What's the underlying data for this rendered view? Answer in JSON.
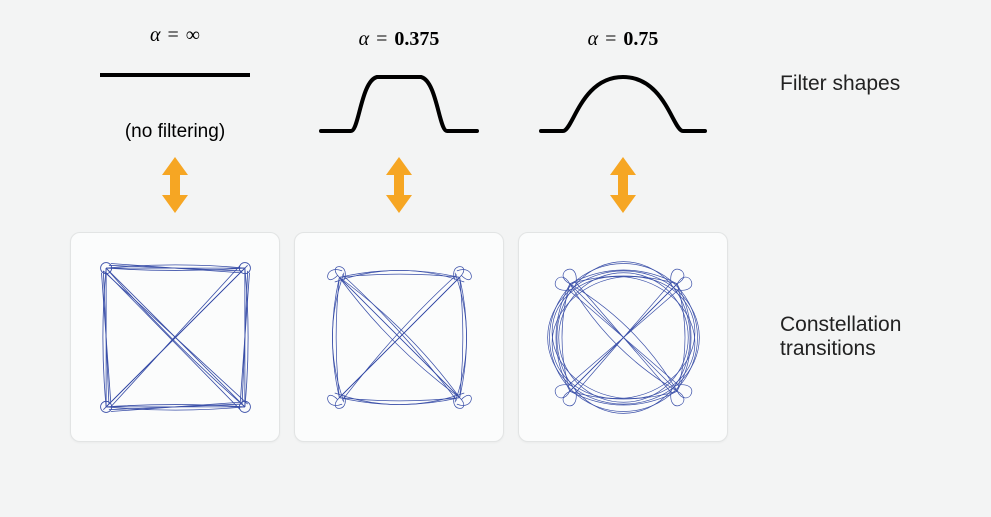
{
  "columns": [
    {
      "alpha_symbol": "α",
      "equals": "=",
      "value": "∞",
      "subtitle": "(no filtering)"
    },
    {
      "alpha_symbol": "α",
      "equals": "=",
      "value": "0.375",
      "subtitle": ""
    },
    {
      "alpha_symbol": "α",
      "equals": "=",
      "value": "0.75",
      "subtitle": ""
    }
  ],
  "labels": {
    "filter_shapes": "Filter shapes",
    "constellations": "Constellation transitions"
  },
  "colors": {
    "arrow": "#f6a623",
    "trace": "#3a4fa8",
    "stroke": "#000000"
  }
}
